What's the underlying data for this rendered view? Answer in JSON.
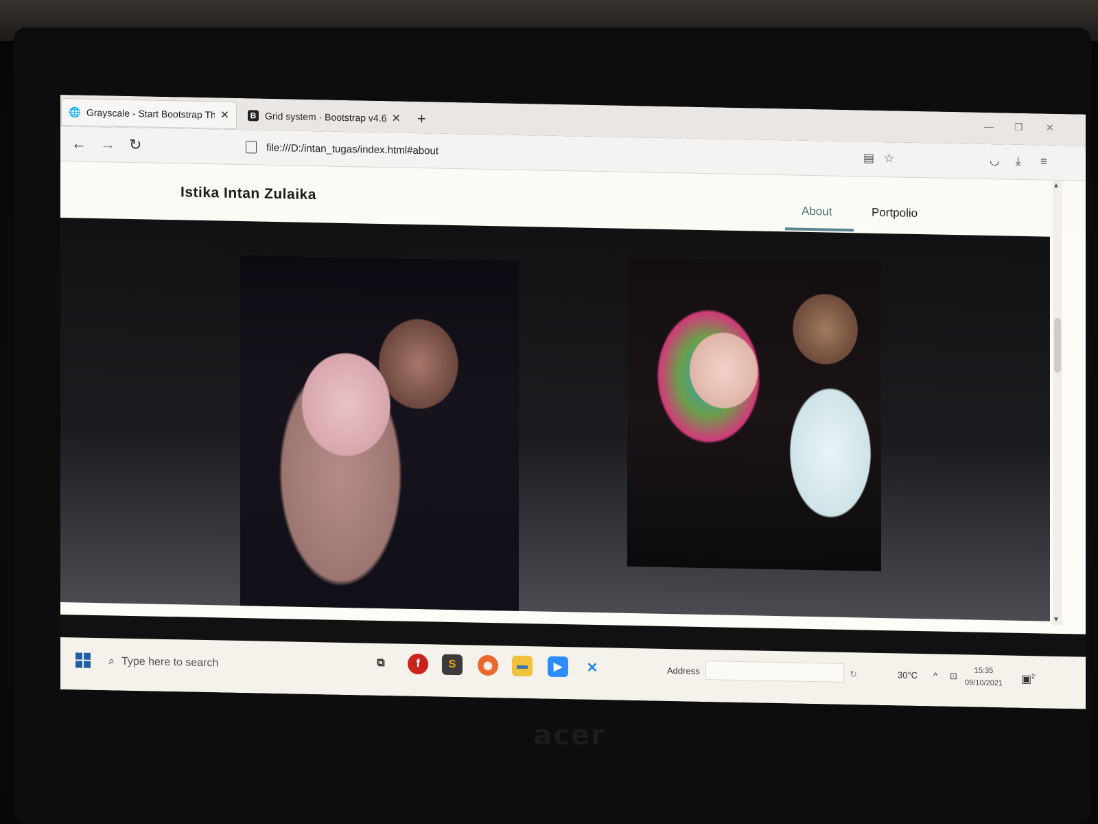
{
  "browser": {
    "tabs": [
      {
        "title": "Grayscale - Start Bootstrap The",
        "icon": "globe-icon",
        "active": true
      },
      {
        "title": "Grid system · Bootstrap v4.6",
        "icon": "bootstrap-icon",
        "badge": "B",
        "active": false
      }
    ],
    "new_tab": "+",
    "url": "file:///D:/intan_tugas/index.html#about"
  },
  "site": {
    "brand": "Istika Intan Zulaika",
    "nav": [
      {
        "label": "About",
        "active": true
      },
      {
        "label": "Portpolio",
        "active": false
      }
    ],
    "accent_color": "#5c8590"
  },
  "taskbar": {
    "search_placeholder": "Type here to search",
    "address_label": "Address",
    "temperature": "30°C",
    "time": "15:35",
    "date": "09/10/2021",
    "notification_count": "2"
  },
  "monitor": {
    "brand": "acer"
  }
}
